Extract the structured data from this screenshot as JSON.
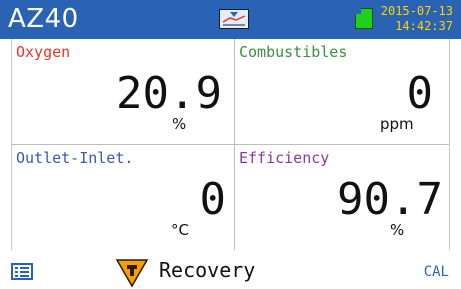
{
  "header": {
    "title": "AZ40",
    "date": "2015-07-13",
    "time": "14:42:37",
    "status_icon": "analyzer-status-icon",
    "storage_icon": "sd-card-icon"
  },
  "cells": [
    {
      "label": "Oxygen",
      "value": "20.9",
      "unit": "%",
      "label_color": "#e8352a"
    },
    {
      "label": "Combustibles",
      "value": "0",
      "unit": "ppm",
      "label_color": "#3f8f3f"
    },
    {
      "label": "Outlet-Inlet.",
      "value": "0",
      "unit": "°C",
      "label_color": "#3a5aa8"
    },
    {
      "label": "Efficiency",
      "value": "90.7",
      "unit": "%",
      "label_color": "#8a3a9a"
    }
  ],
  "footer": {
    "menu_icon": "list-menu-icon",
    "warning_icon": "warning-wrench-icon",
    "status_text": "Recovery",
    "cal_label": "CAL"
  },
  "colors": {
    "accent": "#2b63b4",
    "datetime": "#ffd400",
    "warning": "#f5a000"
  }
}
